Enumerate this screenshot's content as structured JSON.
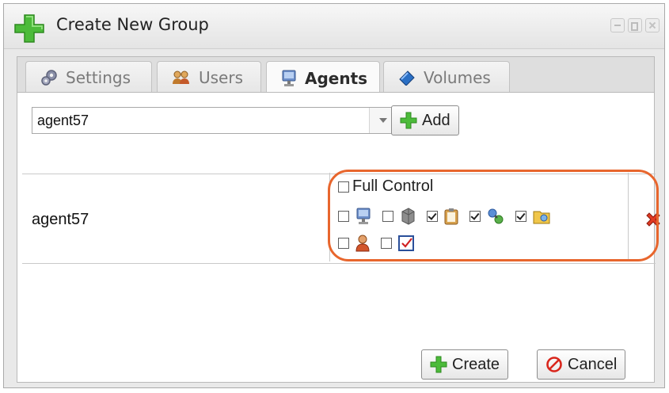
{
  "dialog": {
    "title": "Create New Group"
  },
  "tabs": [
    {
      "label": "Settings",
      "icon": "gear-icon",
      "active": false
    },
    {
      "label": "Users",
      "icon": "users-icon",
      "active": false
    },
    {
      "label": "Agents",
      "icon": "computer-icon",
      "active": true
    },
    {
      "label": "Volumes",
      "icon": "volume-icon",
      "active": false
    }
  ],
  "agent_select": {
    "value": "agent57"
  },
  "add_button": {
    "label": "Add",
    "icon": "plus-icon"
  },
  "agent_row": {
    "name": "agent57",
    "full_control": {
      "label": "Full Control",
      "checked": false
    },
    "permissions": [
      {
        "icon": "computer-icon",
        "checked": false
      },
      {
        "icon": "server-icon",
        "checked": false
      },
      {
        "icon": "clipboard-icon",
        "checked": true
      },
      {
        "icon": "network-icon",
        "checked": true
      },
      {
        "icon": "folder-icon",
        "checked": true
      },
      {
        "icon": "user-icon",
        "checked": false
      },
      {
        "icon": "checklist-icon",
        "checked": false
      }
    ],
    "delete_icon": "delete-icon"
  },
  "footer": {
    "create_label": "Create",
    "cancel_label": "Cancel"
  },
  "colors": {
    "highlight": "#e8662d",
    "plus": "#3fae2a",
    "delete": "#d9261c"
  }
}
